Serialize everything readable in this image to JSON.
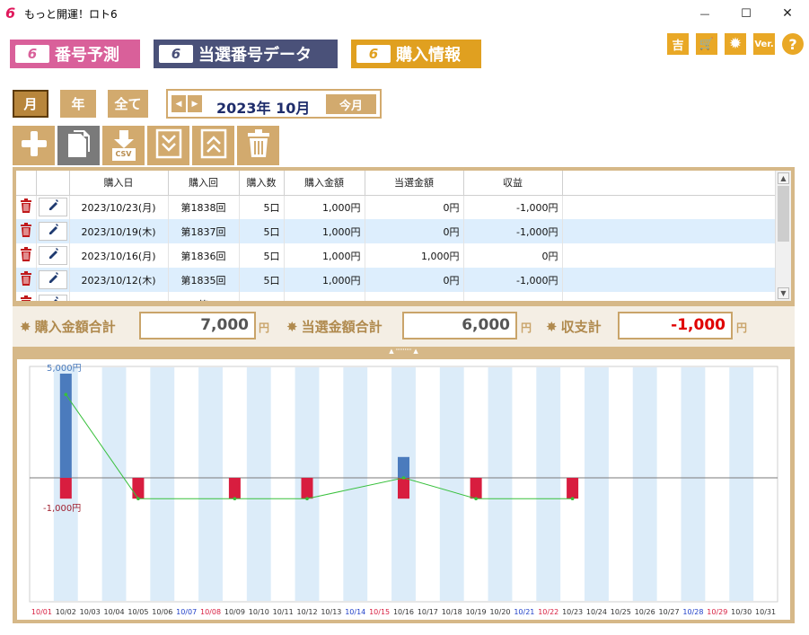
{
  "window": {
    "logo": "6",
    "title": "もっと開運！ロト6",
    "minimize_glyph": "—",
    "maximize_glyph": "☐",
    "close_glyph": "✕"
  },
  "nav": {
    "badge": "6",
    "predict": "番号予測",
    "data": "当選番号データ",
    "purchase": "購入情報"
  },
  "top_icons": [
    {
      "name": "fortune-icon",
      "label": "吉"
    },
    {
      "name": "cart-icon",
      "label": "🛒"
    },
    {
      "name": "gear-icon",
      "label": "✹"
    },
    {
      "name": "version-icon",
      "label": "Ver."
    },
    {
      "name": "help-icon",
      "label": "?"
    }
  ],
  "period": {
    "month": "月",
    "year": "年",
    "all": "全て",
    "current": "2023年 10月",
    "today": "今月",
    "prev_glyph": "◀",
    "next_glyph": "▶"
  },
  "toolbar": [
    {
      "name": "add-icon"
    },
    {
      "name": "copy-icon"
    },
    {
      "name": "csv-download-icon",
      "label": "CSV"
    },
    {
      "name": "expand-down-icon"
    },
    {
      "name": "collapse-up-icon"
    },
    {
      "name": "trash-icon"
    }
  ],
  "table": {
    "columns": [
      "購入日",
      "購入回",
      "購入数",
      "購入金額",
      "当選金額",
      "収益"
    ],
    "rows": [
      {
        "date": "2023/10/23(月)",
        "round": "第1838回",
        "qty": "5口",
        "amount": "1,000円",
        "winning": "0円",
        "profit": "-1,000円"
      },
      {
        "date": "2023/10/19(木)",
        "round": "第1837回",
        "qty": "5口",
        "amount": "1,000円",
        "winning": "0円",
        "profit": "-1,000円"
      },
      {
        "date": "2023/10/16(月)",
        "round": "第1836回",
        "qty": "5口",
        "amount": "1,000円",
        "winning": "1,000円",
        "profit": "0円"
      },
      {
        "date": "2023/10/12(木)",
        "round": "第1835回",
        "qty": "5口",
        "amount": "1,000円",
        "winning": "0円",
        "profit": "-1,000円"
      },
      {
        "date": "",
        "round": "第",
        "qty": "",
        "amount": "",
        "winning": "",
        "profit": ""
      }
    ],
    "scroll_up": "▲",
    "scroll_down": "▼"
  },
  "summary": {
    "purchase_label": "購入金額合計",
    "purchase_value": "7,000",
    "winning_label": "当選金額合計",
    "winning_value": "6,000",
    "balance_label": "収支計",
    "balance_value": "-1,000",
    "unit": "円",
    "star": "✸"
  },
  "splitter_glyph": "▲ ''''''''' ▲",
  "colors": {
    "purchase_bar": "#4b7bbd",
    "profit_negative_bar": "#d81d3f",
    "line": "#38c03c",
    "stripe": "#dcecf9",
    "weekday_label": "#333333",
    "saturday_label": "#1f3fc8",
    "sunday_label": "#d81d3f",
    "balance_value": "#e00000"
  },
  "chart_data": {
    "type": "bar",
    "y_top_label": "5,000円",
    "y_bottom_label": "-1,000円",
    "ylim": [
      -1000,
      5000
    ],
    "categories": [
      "10/01",
      "10/02",
      "10/03",
      "10/04",
      "10/05",
      "10/06",
      "10/07",
      "10/08",
      "10/09",
      "10/10",
      "10/11",
      "10/12",
      "10/13",
      "10/14",
      "10/15",
      "10/16",
      "10/17",
      "10/18",
      "10/19",
      "10/20",
      "10/21",
      "10/22",
      "10/23",
      "10/24",
      "10/25",
      "10/26",
      "10/27",
      "10/28",
      "10/29",
      "10/30",
      "10/31"
    ],
    "category_kind": [
      "sun",
      "wd",
      "wd",
      "wd",
      "wd",
      "wd",
      "sat",
      "sun",
      "wd",
      "wd",
      "wd",
      "wd",
      "wd",
      "sat",
      "sun",
      "wd",
      "wd",
      "wd",
      "wd",
      "wd",
      "sat",
      "sun",
      "wd",
      "wd",
      "wd",
      "wd",
      "wd",
      "sat",
      "sun",
      "wd",
      "wd"
    ],
    "series": [
      {
        "values": [
          0,
          5000,
          0,
          0,
          0,
          0,
          0,
          0,
          0,
          0,
          0,
          0,
          0,
          0,
          0,
          1000,
          0,
          0,
          0,
          0,
          0,
          0,
          0,
          0,
          0,
          0,
          0,
          0,
          0,
          0,
          0
        ]
      },
      {
        "values": [
          0,
          -1000,
          0,
          0,
          -1000,
          0,
          0,
          0,
          -1000,
          0,
          0,
          -1000,
          0,
          0,
          0,
          -1000,
          0,
          0,
          -1000,
          0,
          0,
          0,
          -1000,
          0,
          0,
          0,
          0,
          0,
          0,
          0,
          0
        ]
      },
      {
        "type": "line",
        "points": [
          [
            "10/02",
            4000
          ],
          [
            "10/05",
            -1000
          ],
          [
            "10/09",
            -1000
          ],
          [
            "10/12",
            -1000
          ],
          [
            "10/16",
            0
          ],
          [
            "10/19",
            -1000
          ],
          [
            "10/23",
            -1000
          ]
        ]
      }
    ]
  }
}
